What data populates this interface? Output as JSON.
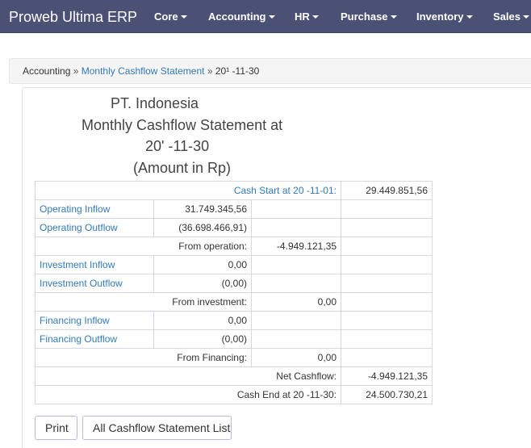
{
  "app": {
    "brand": "Proweb Ultima ERP"
  },
  "nav": [
    {
      "label": "Core"
    },
    {
      "label": "Accounting"
    },
    {
      "label": "HR"
    },
    {
      "label": "Purchase"
    },
    {
      "label": "Inventory"
    },
    {
      "label": "Sales"
    }
  ],
  "breadcrumb": {
    "root": "Accounting",
    "sep": "»",
    "link": "Monthly Cashflow Statement",
    "current": "20¹   -11-30"
  },
  "header": {
    "company": "PT.              Indonesia",
    "title": "Monthly Cashflow Statement at",
    "date": "20'     -11-30",
    "unit": "(Amount in Rp)"
  },
  "table": {
    "cash_start_label": "Cash Start at 20    -11-01:",
    "cash_start_value": "29.449.851,56",
    "operating_inflow_label": "Operating Inflow",
    "operating_inflow_value": "31.749.345,56",
    "operating_outflow_label": "Operating Outflow",
    "operating_outflow_value": "(36.698.466,91)",
    "from_operation_label": "From operation:",
    "from_operation_value": "-4.949.121,35",
    "investment_inflow_label": "Investment Inflow",
    "investment_inflow_value": "0,00",
    "investment_outflow_label": "Investment Outflow",
    "investment_outflow_value": "(0,00)",
    "from_investment_label": "From investment:",
    "from_investment_value": "0,00",
    "financing_inflow_label": "Financing Inflow",
    "financing_inflow_value": "0,00",
    "financing_outflow_label": "Financing Outflow",
    "financing_outflow_value": "(0,00)",
    "from_financing_label": "From Financing:",
    "from_financing_value": "0,00",
    "net_cashflow_label": "Net Cashflow:",
    "net_cashflow_value": "-4.949.121,35",
    "cash_end_label": "Cash End at 20      -11-30:",
    "cash_end_value": "24.500.730,21"
  },
  "actions": {
    "print_label": "Print",
    "list_label": "All Cashflow Statement List"
  },
  "colors": {
    "navbar": "#4a5174",
    "link": "#337ab7",
    "table_border": "#d6d6e8"
  }
}
